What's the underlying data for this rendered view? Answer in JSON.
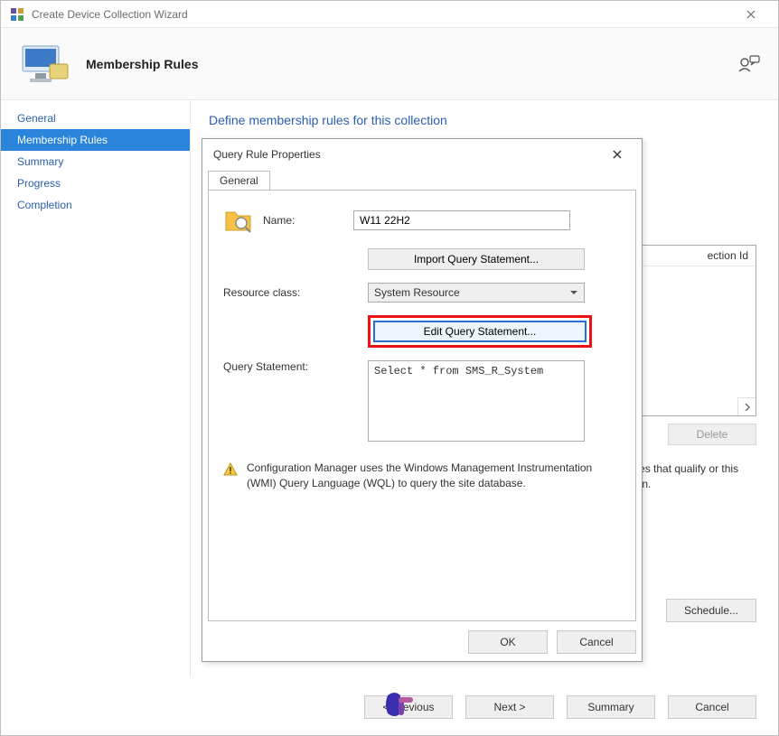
{
  "window": {
    "title": "Create Device Collection Wizard",
    "header": "Membership Rules"
  },
  "nav": {
    "items": [
      {
        "label": "General"
      },
      {
        "label": "Membership Rules",
        "selected": true
      },
      {
        "label": "Summary"
      },
      {
        "label": "Progress"
      },
      {
        "label": "Completion"
      }
    ]
  },
  "content": {
    "hidden_heading": "Define membership rules for this collection",
    "list_header_fragment": "ection Id",
    "delete_label": "Delete",
    "desc_fragment": "resources that qualify or this collection.",
    "schedule_label": "Schedule..."
  },
  "footer": {
    "previous": "< Previous",
    "next": "Next >",
    "summary": "Summary",
    "cancel": "Cancel"
  },
  "dialog": {
    "title": "Query Rule Properties",
    "tab": "General",
    "name_label": "Name:",
    "name_value": "W11 22H2",
    "import_btn": "Import Query Statement...",
    "resource_label": "Resource class:",
    "resource_value": "System Resource",
    "edit_btn": "Edit Query Statement...",
    "query_label": "Query Statement:",
    "query_value": "Select * from SMS_R_System",
    "info_text": "Configuration Manager uses the Windows Management Instrumentation (WMI) Query Language (WQL) to query the site database.",
    "ok": "OK",
    "cancel": "Cancel"
  }
}
